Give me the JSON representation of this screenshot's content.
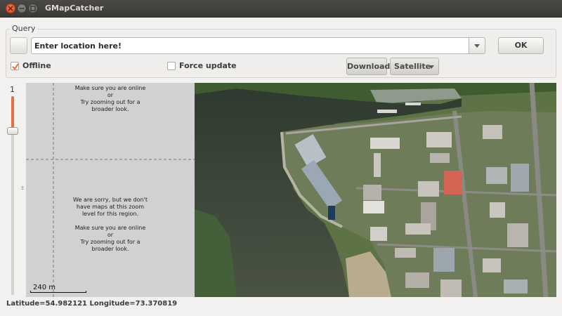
{
  "window": {
    "title": "GMapCatcher"
  },
  "query": {
    "group_label": "Query",
    "location_value": "Enter location here!",
    "ok_label": "OK",
    "offline_label": "Offline",
    "offline_checked": true,
    "force_update_label": "Force update",
    "force_update_checked": false,
    "download_label": "Download",
    "map_type_selected": "Satellite"
  },
  "zoom": {
    "level": "1",
    "slider_fraction": 0.16
  },
  "map": {
    "no_tile_messages": [
      {
        "lines": [
          "Make sure you are online",
          "or",
          "Try zooming out for a",
          "broader look."
        ]
      },
      {
        "lines": [
          "We are sorry, but we don't",
          "have maps at this zoom",
          "level for this region.",
          "",
          "Make sure you are online",
          "or",
          "Try zooming out for a",
          "broader look."
        ]
      }
    ],
    "scale_label": "240 m"
  },
  "status": {
    "text": "Latitude=54.982121 Longitude=73.370819"
  },
  "colors": {
    "accent": "#e6703c",
    "close_button": "#df5a2a"
  }
}
